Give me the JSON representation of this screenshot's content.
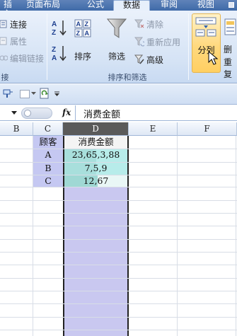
{
  "tabs": [
    {
      "label": "插入",
      "active": false
    },
    {
      "label": "页面布局",
      "active": false
    },
    {
      "label": "公式",
      "active": false
    },
    {
      "label": "数据",
      "active": true
    },
    {
      "label": "审阅",
      "active": false
    },
    {
      "label": "视图",
      "active": false
    }
  ],
  "connections_group": {
    "items": [
      {
        "label": "连接",
        "enabled": true,
        "icon": "connections-icon"
      },
      {
        "label": "属性",
        "enabled": false,
        "icon": "properties-icon"
      },
      {
        "label": "编辑链接",
        "enabled": false,
        "icon": "edit-links-icon"
      }
    ],
    "group_label": "接"
  },
  "sort_filter_group": {
    "sort_asc_icon": "sort-a-to-z-icon",
    "sort_desc_icon": "sort-z-to-a-icon",
    "sort_label": "排序",
    "filter_label": "筛选",
    "clear_label": "清除",
    "reapply_label": "重新应用",
    "advanced_label": "高级",
    "group_label": "排序和筛选"
  },
  "data_tools_group": {
    "split_label": "分列",
    "remove_dup_label": "删",
    "remove_dup_label_2": "重复"
  },
  "formula_bar": {
    "name_box": "",
    "fx_label": "fx",
    "content": "消费金额"
  },
  "sheet": {
    "columns": [
      {
        "label": "B",
        "selected": false
      },
      {
        "label": "C",
        "selected": false
      },
      {
        "label": "D",
        "selected": true
      },
      {
        "label": "E",
        "selected": false
      },
      {
        "label": "F",
        "selected": false
      }
    ],
    "rows": [
      {
        "c": "顾客",
        "d": "消费金额"
      },
      {
        "c": "A",
        "d": "23,65,3,88"
      },
      {
        "c": "B",
        "d": "7,5,9"
      },
      {
        "c": "C",
        "d": "12,67"
      }
    ]
  },
  "colors": {
    "selection_fill": "#c9c8f0",
    "c_column_fill": "#c5c8f2",
    "d_data_fill": "#b7ecea",
    "active_tab": "#e6effb"
  }
}
